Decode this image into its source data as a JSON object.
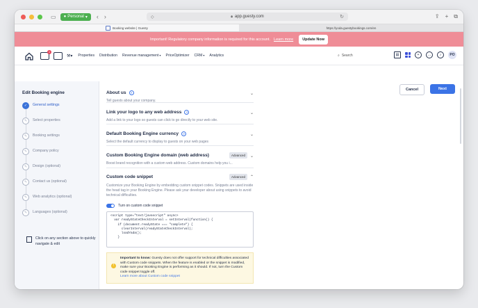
{
  "browser": {
    "profile": "Personal",
    "url": "app.guesty.com",
    "tabs": [
      {
        "label": "Booking website | Guesty",
        "active": true
      },
      {
        "label": "https://yoda.guestybookings.com/en",
        "active": false
      }
    ]
  },
  "banner": {
    "text": "Important! Regulatory company information is required for this account.",
    "link": "Learn more",
    "button": "Update Now"
  },
  "nav": {
    "badge": "1",
    "menu": [
      {
        "label": "Properties",
        "dropdown": false
      },
      {
        "label": "Distribution",
        "dropdown": false
      },
      {
        "label": "Revenue management",
        "dropdown": true
      },
      {
        "label": "PriceOptimizer",
        "dropdown": false
      },
      {
        "label": "CRM",
        "dropdown": true
      },
      {
        "label": "Analytics",
        "dropdown": false
      }
    ],
    "search_placeholder": "Search",
    "avatar": "PO"
  },
  "sidebar": {
    "title": "Edit Booking engine",
    "steps": [
      {
        "label": "General settings",
        "active": true
      },
      {
        "label": "Select properties",
        "active": false
      },
      {
        "label": "Booking settings",
        "active": false
      },
      {
        "label": "Company policy",
        "active": false
      },
      {
        "label": "Design (optional)",
        "active": false
      },
      {
        "label": "Contact us (optional)",
        "active": false
      },
      {
        "label": "Web analytics (optional)",
        "active": false
      },
      {
        "label": "Languages (optional)",
        "active": false
      }
    ],
    "hint": "Click on any section above to quickly navigate & edit"
  },
  "actions": {
    "cancel": "Cancel",
    "next": "Next"
  },
  "sections": [
    {
      "title": "About us",
      "desc": "Tell guests about your company.",
      "help": true,
      "advanced": false
    },
    {
      "title": "Link your logo to any web address",
      "desc": "Add a link to your logo so guests can click to go directly to your web site.",
      "help": true,
      "advanced": false
    },
    {
      "title": "Default Booking Engine currency",
      "desc": "Select the default currency to display to guests on your web pages",
      "help": true,
      "advanced": false
    },
    {
      "title": "Custom Booking Engine domain (web address)",
      "desc": "Boost brand recognition with a custom web address. Custom domains help you i...",
      "help": false,
      "advanced": true
    }
  ],
  "advanced_label": "Advanced",
  "snippet": {
    "title": "Custom code snippet",
    "desc": "Customize your Booking Engine by embedding custom snippet codes. Snippets are used inside the head tag in your Booking Engine. Please ask your developer about using snippets to avoid technical difficulties.",
    "toggle_label": "Turn on custom code snippet",
    "code_lines": [
      "<script type=\"text/javascript\" async>",
      "  var readyStateCheckInterval = setInterval(function() {",
      "    if (document.readyState === \"complete\") {",
      "      clearInterval(readyStateCheckInterval);",
      "      loadYada();",
      "    }"
    ],
    "warning_bold": "Important to know:",
    "warning_text": " Guesty does not offer support for technical difficulties associated with Custom code snippets. When the feature is enabled or the snippet is modified, make sure your Booking Engine is performing as it should. If not, turn the Custom code snippet toggle off.",
    "warning_link": "Learn more about Custom code snippet"
  },
  "colors": {
    "accent": "#3b73e6",
    "banner": "#ef8d97",
    "warning_bg": "#fdf8e2"
  }
}
